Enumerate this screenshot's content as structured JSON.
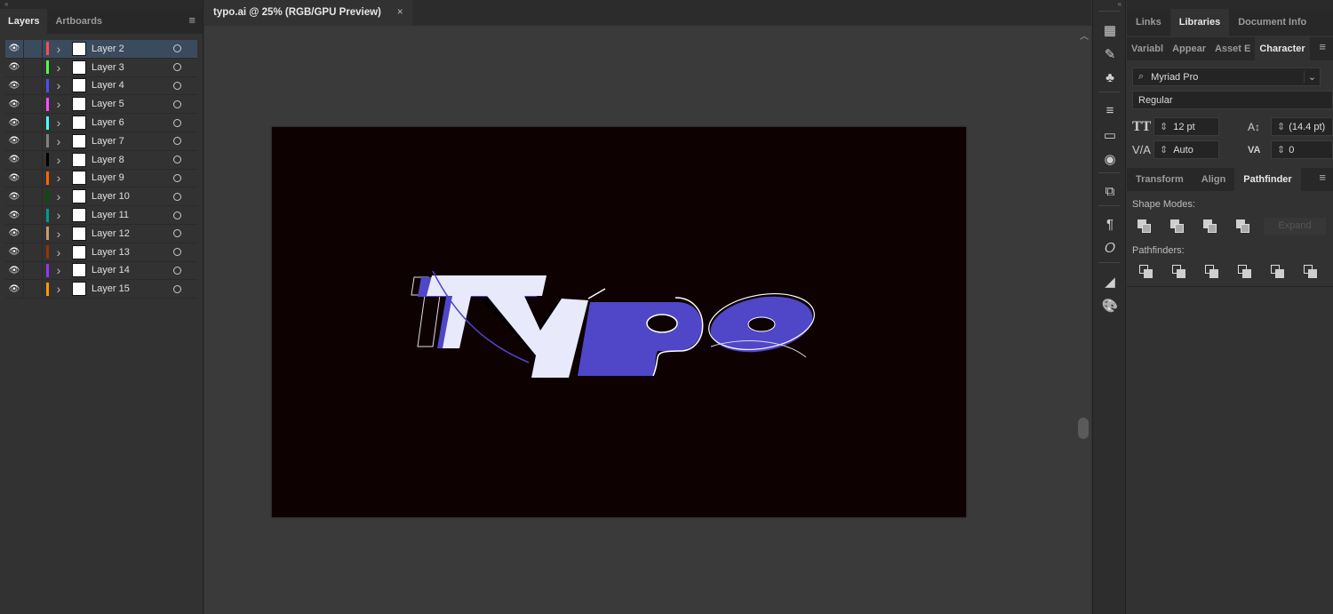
{
  "layers_panel": {
    "tabs": [
      {
        "label": "Layers",
        "active": true
      },
      {
        "label": "Artboards",
        "active": false
      }
    ],
    "layers": [
      {
        "name": "Layer 2",
        "color": "#ff4d4d",
        "selected": true
      },
      {
        "name": "Layer 3",
        "color": "#4dff4d"
      },
      {
        "name": "Layer 4",
        "color": "#4d4dff"
      },
      {
        "name": "Layer 5",
        "color": "#ff4dff"
      },
      {
        "name": "Layer 6",
        "color": "#4dffff"
      },
      {
        "name": "Layer 7",
        "color": "#808080"
      },
      {
        "name": "Layer 8",
        "color": "#000000"
      },
      {
        "name": "Layer 9",
        "color": "#ff6600"
      },
      {
        "name": "Layer 10",
        "color": "#005500"
      },
      {
        "name": "Layer 11",
        "color": "#009999"
      },
      {
        "name": "Layer 12",
        "color": "#cc9966"
      },
      {
        "name": "Layer 13",
        "color": "#993300"
      },
      {
        "name": "Layer 14",
        "color": "#9933ff"
      },
      {
        "name": "Layer 15",
        "color": "#ff9900"
      }
    ]
  },
  "document": {
    "tab_title": "typo.ai @ 25% (RGB/GPU Preview)",
    "close": "×",
    "artboard_color": "#0e0102",
    "art_colors": {
      "light": "#e8eafc",
      "purple": "#5046c8"
    }
  },
  "right_panel": {
    "top_tabs": [
      {
        "label": "Links"
      },
      {
        "label": "Libraries",
        "active": true
      },
      {
        "label": "Document Info"
      }
    ],
    "sub_tabs": [
      {
        "label": "Variabl"
      },
      {
        "label": "Appear"
      },
      {
        "label": "Asset E"
      },
      {
        "label": "Character",
        "active": true
      }
    ],
    "character": {
      "font_family": "Myriad Pro",
      "font_style": "Regular",
      "font_size": "12 pt",
      "leading": "(14.4 pt)",
      "kerning": "Auto",
      "tracking": "0"
    },
    "lower_tabs": [
      {
        "label": "Transform"
      },
      {
        "label": "Align"
      },
      {
        "label": "Pathfinder",
        "active": true
      }
    ],
    "pathfinder": {
      "shape_modes_label": "Shape Modes:",
      "pathfinders_label": "Pathfinders:",
      "expand_label": "Expand"
    }
  },
  "toolbar_icons": [
    "libraries-icon",
    "brushes-icon",
    "symbols-icon",
    "stroke-icon",
    "gradient-icon",
    "transparency-icon",
    "artboards-icon",
    "paragraph-icon",
    "opentype-icon",
    "image-trace-icon",
    "color-guide-icon"
  ]
}
